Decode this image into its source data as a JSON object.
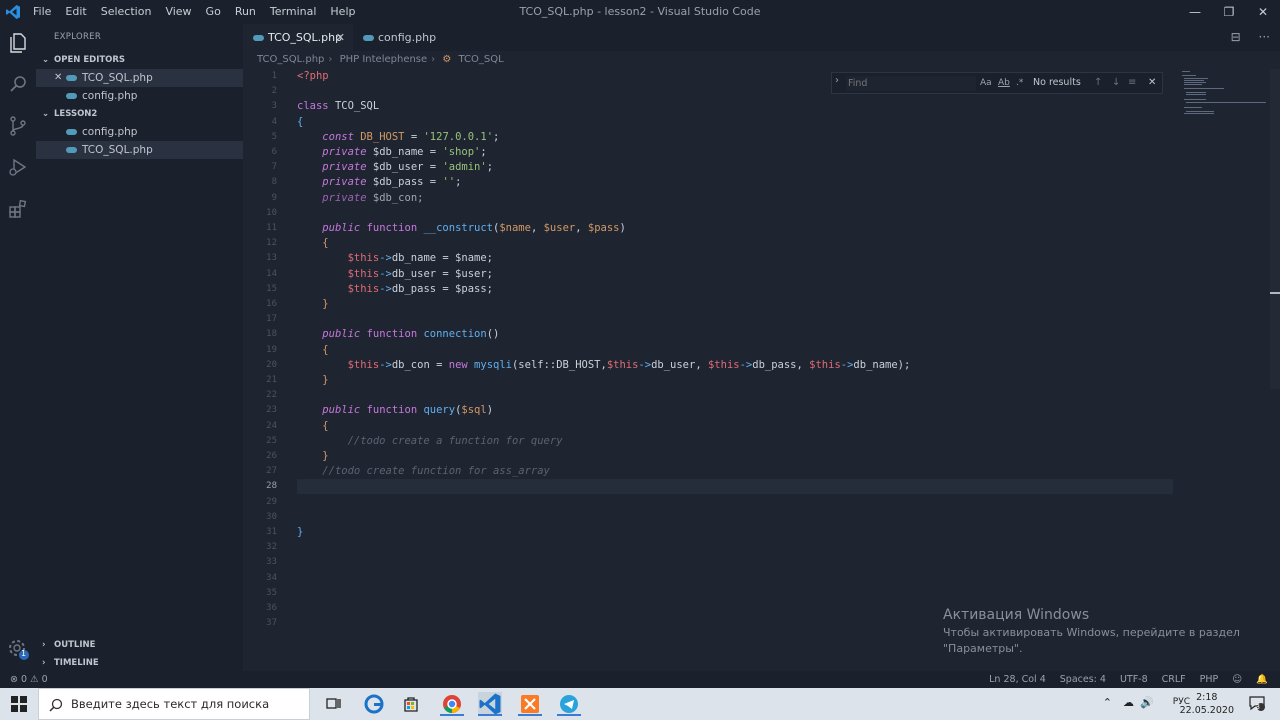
{
  "window": {
    "title": "TCO_SQL.php - lesson2 - Visual Studio Code",
    "menu": [
      "File",
      "Edit",
      "Selection",
      "View",
      "Go",
      "Run",
      "Terminal",
      "Help"
    ],
    "controls": [
      "—",
      "❐",
      "✕"
    ]
  },
  "sidebar": {
    "title": "EXPLORER",
    "open_editors_label": "OPEN EDITORS",
    "open_editors": [
      "TCO_SQL.php",
      "config.php"
    ],
    "project_label": "LESSON2",
    "project_files": [
      "config.php",
      "TCO_SQL.php"
    ],
    "outline_label": "OUTLINE",
    "timeline_label": "TIMELINE",
    "settings_badge": "1"
  },
  "tabs": [
    {
      "label": "TCO_SQL.php",
      "close": "✕"
    },
    {
      "label": "config.php"
    }
  ],
  "tab_actions": [
    "⊟",
    "···"
  ],
  "breadcrumb": [
    "TCO_SQL.php",
    "PHP Intelephense",
    "TCO_SQL"
  ],
  "find": {
    "placeholder": "Find",
    "options": [
      "Aa",
      "Ab",
      ".*"
    ],
    "results": "No results",
    "buttons": [
      "↑",
      "↓",
      "≡",
      "✕"
    ]
  },
  "editor": {
    "line_numbers": [
      "1",
      "2",
      "3",
      "4",
      "5",
      "6",
      "7",
      "8",
      "9",
      "10",
      "11",
      "12",
      "13",
      "14",
      "15",
      "16",
      "17",
      "18",
      "19",
      "20",
      "21",
      "22",
      "23",
      "24",
      "25",
      "26",
      "27",
      "28",
      "29",
      "30",
      "31",
      "32",
      "33",
      "34",
      "35",
      "36",
      "37"
    ],
    "current_line": 28
  },
  "statusbar": {
    "problems": "⊗ 0 ⚠ 0",
    "position": "Ln 28, Col 4",
    "spaces": "Spaces: 4",
    "encoding": "UTF-8",
    "eol": "CRLF",
    "language": "PHP"
  },
  "watermark": {
    "line1": "Активация Windows",
    "line2": "Чтобы активировать Windows, перейдите в раздел",
    "line3": "\"Параметры\"."
  },
  "taskbar": {
    "search_placeholder": "Введите здесь текст для поиска",
    "lang": "РУС",
    "time": "2:18",
    "date": "22.05.2020",
    "notification_count": "3"
  },
  "colors": {
    "accent": "#007acc",
    "editor_bg": "#1e2430",
    "sidebar_bg": "#1b212c"
  }
}
